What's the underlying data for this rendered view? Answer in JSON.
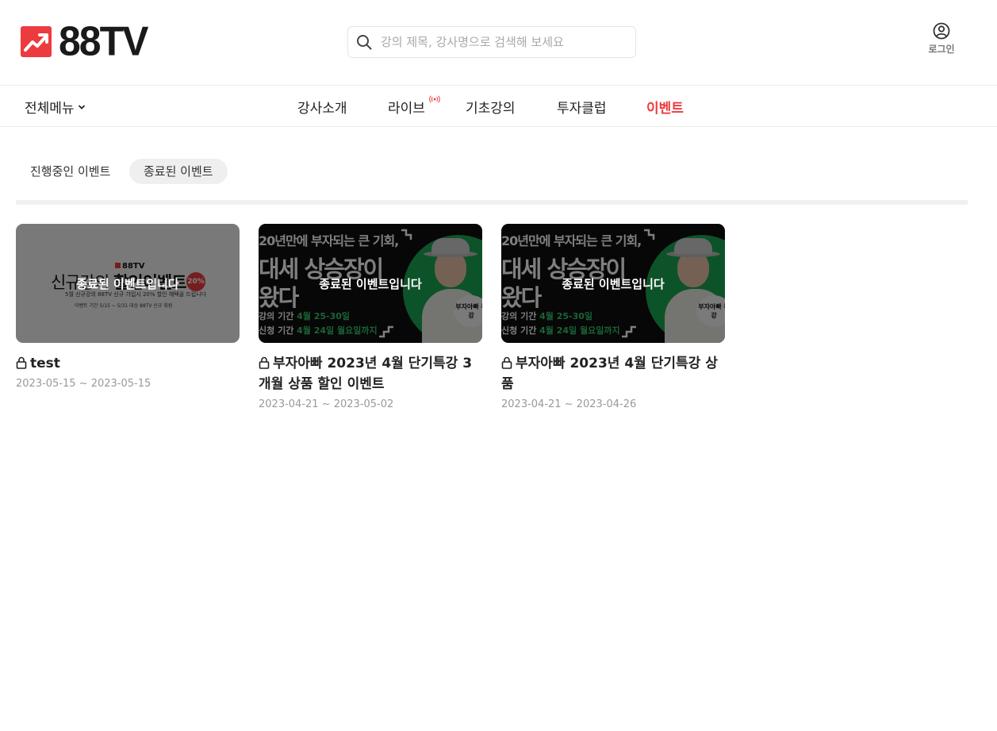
{
  "header": {
    "logo_text": "88TV",
    "search_placeholder": "강의 제목, 강사명으로 검색해 보세요",
    "login_label": "로그인",
    "colors": {
      "brand": "#ec3b3f"
    }
  },
  "nav": {
    "all_menu": "전체메뉴",
    "items": [
      {
        "label": "강사소개"
      },
      {
        "label": "라이브"
      },
      {
        "label": "기초강의"
      },
      {
        "label": "투자클럽"
      },
      {
        "label": "이벤트",
        "active": true
      }
    ]
  },
  "tabs": {
    "ongoing": "진행중인 이벤트",
    "ended": "종료된 이벤트"
  },
  "events": [
    {
      "title": "test",
      "date": "2023-05-15 ~ 2023-05-15",
      "overlay": "종료된 이벤트입니다",
      "thumb": {
        "brand": "88TV",
        "headline_a": "신규강의 ",
        "headline_b": "할인이벤트",
        "badge": "20%",
        "sub": "5월 신규강의 88TV 신규 가입시 20% 할인 혜택을 드립니다",
        "info": "이벤트 기간  5/15 ~ 5/31   대상  88TV 신규 회원"
      }
    },
    {
      "title": "부자아빠 2023년 4월 단기특강 3개월 상품 할인 이벤트",
      "date": "2023-04-21 ~ 2023-05-02",
      "overlay": "종료된 이벤트입니다",
      "thumb": {
        "line1": "20년만에 부자되는 큰 기회,",
        "line2": "대세 상승장이",
        "line3": "왔다",
        "line4_label": "강의 기간 ",
        "line4_value": "4월 25-30일",
        "line5_label": "신청 기간 ",
        "line5_value": "4월 24일 월요일까지",
        "bubble": "부자아빠 특강"
      }
    },
    {
      "title": "부자아빠 2023년 4월 단기특강 상품",
      "date": "2023-04-21 ~ 2023-04-26",
      "overlay": "종료된 이벤트입니다",
      "thumb": {
        "line1": "20년만에 부자되는 큰 기회,",
        "line2": "대세 상승장이",
        "line3": "왔다",
        "line4_label": "강의 기간 ",
        "line4_value": "4월 25-30일",
        "line5_label": "신청 기간 ",
        "line5_value": "4월 24일 월요일까지",
        "bubble": "부자아빠 특강"
      }
    }
  ]
}
